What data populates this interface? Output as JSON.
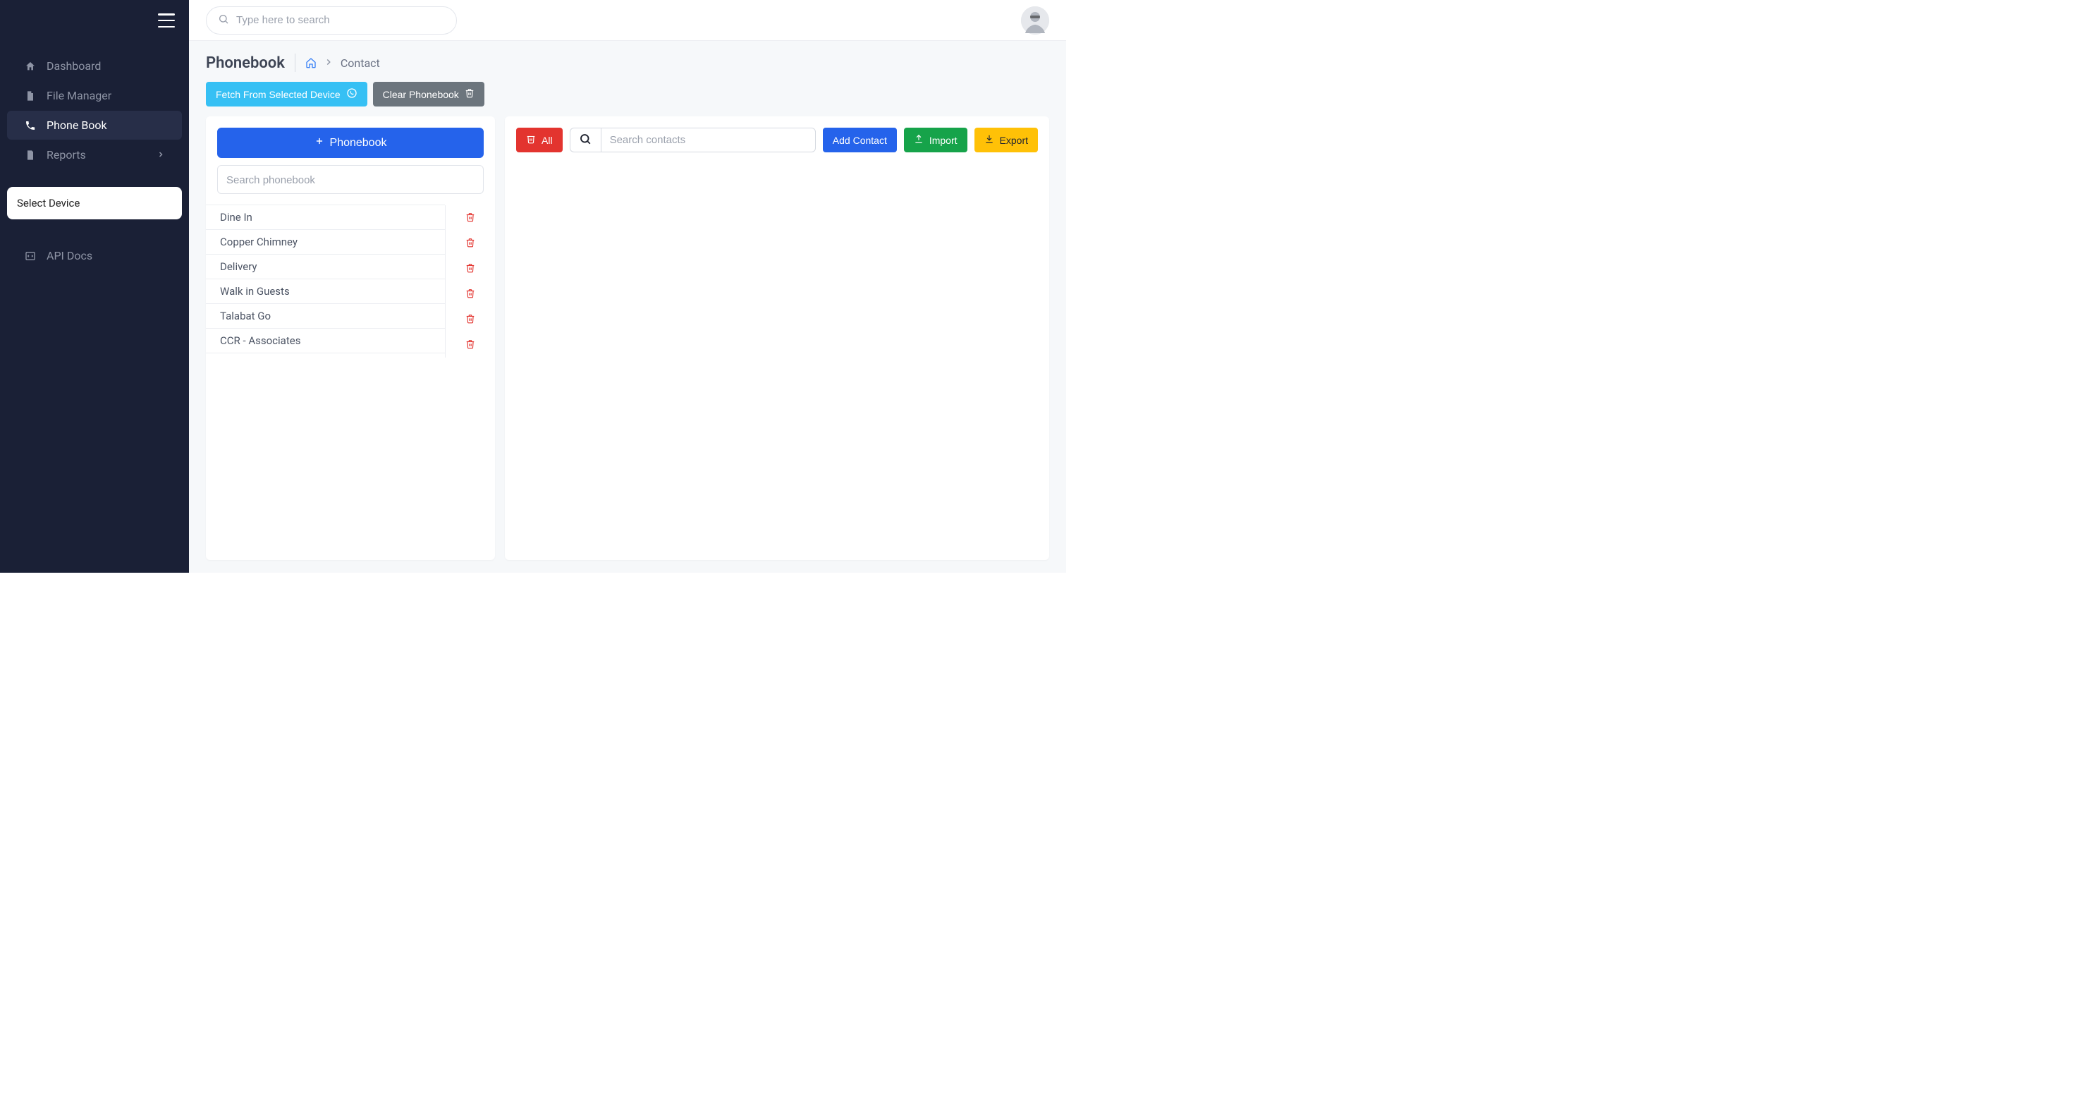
{
  "header": {
    "search_placeholder": "Type here to search"
  },
  "sidebar": {
    "items": [
      {
        "label": "Dashboard"
      },
      {
        "label": "File Manager"
      },
      {
        "label": "Phone Book"
      },
      {
        "label": "Reports"
      }
    ],
    "select_device": "Select Device",
    "api_docs": "API Docs"
  },
  "page": {
    "title": "Phonebook",
    "breadcrumb": "Contact",
    "fetch_label": "Fetch From Selected Device",
    "clear_label": "Clear Phonebook"
  },
  "left_panel": {
    "add_phonebook_label": "Phonebook",
    "search_placeholder": "Search phonebook",
    "phonebooks": [
      "Dine In",
      "Copper Chimney",
      "Delivery",
      "Walk in Guests",
      "Talabat Go",
      "CCR - Associates"
    ]
  },
  "right_panel": {
    "all_label": "All",
    "search_placeholder": "Search contacts",
    "add_contact_label": "Add Contact",
    "import_label": "Import",
    "export_label": "Export"
  }
}
